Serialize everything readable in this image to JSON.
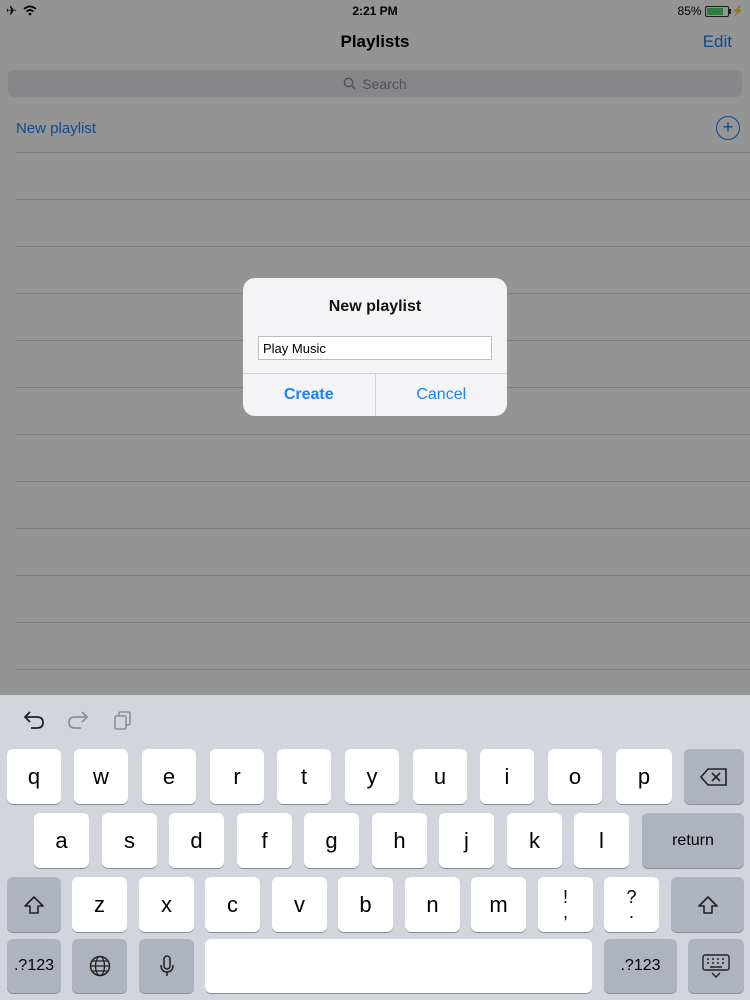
{
  "status": {
    "time": "2:21 PM",
    "battery_percent": "85%",
    "battery_level": 0.85
  },
  "nav": {
    "title": "Playlists",
    "edit_label": "Edit"
  },
  "search": {
    "placeholder": "Search"
  },
  "new_playlist_row": {
    "label": "New playlist"
  },
  "dialog": {
    "title": "New playlist",
    "input_value": "Play Music",
    "create_label": "Create",
    "cancel_label": "Cancel"
  },
  "keyboard": {
    "row1": [
      "q",
      "w",
      "e",
      "r",
      "t",
      "y",
      "u",
      "i",
      "o",
      "p"
    ],
    "row2": [
      "a",
      "s",
      "d",
      "f",
      "g",
      "h",
      "j",
      "k",
      "l"
    ],
    "row3": [
      "z",
      "x",
      "c",
      "v",
      "b",
      "n",
      "m"
    ],
    "return_label": "return",
    "numbers_label": ".?123",
    "punct1_top": "!",
    "punct1_bottom": ",",
    "punct2_top": "?",
    "punct2_bottom": "."
  }
}
